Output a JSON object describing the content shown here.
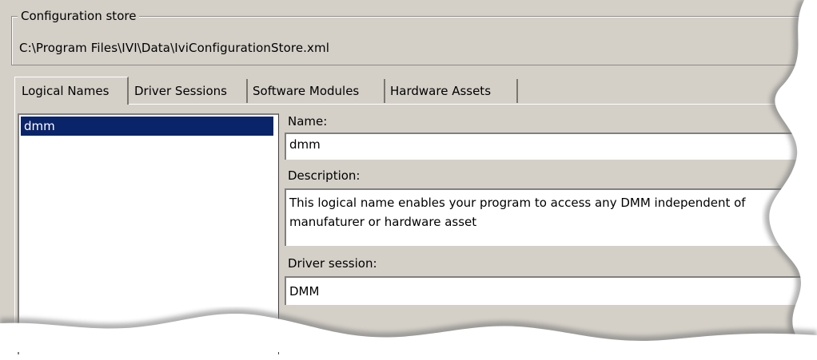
{
  "config_store": {
    "title": "Configuration store",
    "path": "C:\\Program Files\\IVI\\Data\\IviConfigurationStore.xml"
  },
  "tabs": [
    {
      "label": "Logical Names",
      "active": true
    },
    {
      "label": "Driver Sessions",
      "active": false
    },
    {
      "label": "Software Modules",
      "active": false
    },
    {
      "label": "Hardware Assets",
      "active": false
    }
  ],
  "logical_names": {
    "items": [
      "dmm"
    ],
    "selected": "dmm"
  },
  "details": {
    "name_label": "Name:",
    "name_value": "dmm",
    "description_label": "Description:",
    "description_value": "This logical name enables your program to access any DMM independent of manufaturer or hardware asset",
    "driver_session_label": "Driver session:",
    "driver_session_value": "DMM"
  },
  "colors": {
    "dialog_background": "#d4d0c8",
    "selection_background": "#0a246a",
    "selection_text": "#ffffff"
  }
}
